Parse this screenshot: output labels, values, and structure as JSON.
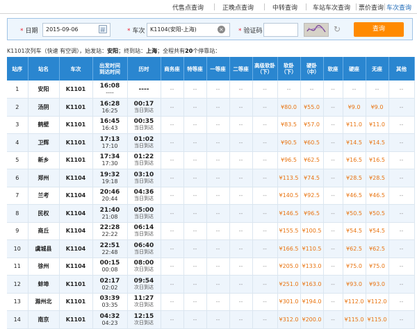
{
  "topnav": {
    "tabs": [
      {
        "label": "代售点查询",
        "active": false
      },
      {
        "label": "正晚点查询",
        "active": false
      },
      {
        "label": "中转查询",
        "active": false
      },
      {
        "label": "车站车次查询",
        "active": false
      },
      {
        "label": "票价查询",
        "active": false
      },
      {
        "label": "车次查询",
        "active": true
      }
    ]
  },
  "query": {
    "date_label": "日期",
    "date_value": "2015-09-06",
    "train_label": "车次",
    "train_value": "K1104(安阳-上海)",
    "captcha_label": "验证码",
    "captcha_value": "",
    "captcha_text": "ઈDR",
    "button_label": "查询",
    "accent_color": "#ff8a00"
  },
  "info": {
    "prefix": "K1101次列车（快速 有空调），始发站：",
    "origin": "安阳",
    "mid": "；终到站：",
    "dest": "上海",
    "suffix_a": "；全程共有",
    "stop_count": "20",
    "suffix_b": "个停靠站："
  },
  "table": {
    "header_color": "#2a86d0",
    "headers": [
      "站序",
      "站名",
      "车次",
      "出发时间\n到达时间",
      "历时",
      "商务座",
      "特等座",
      "一等座",
      "二等座",
      "高级软卧\n（下）",
      "软卧\n（下）",
      "硬卧\n（中）",
      "软座",
      "硬座",
      "无座",
      "其他"
    ],
    "rows": [
      {
        "seq": "1",
        "station": "安阳",
        "train": "K1101",
        "dep": "16:08",
        "arr": "----",
        "dur": "----",
        "day": "",
        "rw": "--",
        "yw": "--",
        "yz": "--",
        "wz": "--"
      },
      {
        "seq": "2",
        "station": "汤阴",
        "train": "K1101",
        "dep": "16:28",
        "arr": "16:25",
        "dur": "00:17",
        "day": "当日到达",
        "rw": "¥80.0",
        "yw": "¥55.0",
        "yz": "¥9.0",
        "wz": "¥9.0"
      },
      {
        "seq": "3",
        "station": "鹤壁",
        "train": "K1101",
        "dep": "16:45",
        "arr": "16:43",
        "dur": "00:35",
        "day": "当日到达",
        "rw": "¥83.5",
        "yw": "¥57.0",
        "yz": "¥11.0",
        "wz": "¥11.0"
      },
      {
        "seq": "4",
        "station": "卫辉",
        "train": "K1101",
        "dep": "17:13",
        "arr": "17:10",
        "dur": "01:02",
        "day": "当日到达",
        "rw": "¥90.5",
        "yw": "¥60.5",
        "yz": "¥14.5",
        "wz": "¥14.5"
      },
      {
        "seq": "5",
        "station": "新乡",
        "train": "K1101",
        "dep": "17:34",
        "arr": "17:30",
        "dur": "01:22",
        "day": "当日到达",
        "rw": "¥96.5",
        "yw": "¥62.5",
        "yz": "¥16.5",
        "wz": "¥16.5"
      },
      {
        "seq": "6",
        "station": "郑州",
        "train": "K1104",
        "dep": "19:32",
        "arr": "19:18",
        "dur": "03:10",
        "day": "当日到达",
        "rw": "¥113.5",
        "yw": "¥74.5",
        "yz": "¥28.5",
        "wz": "¥28.5"
      },
      {
        "seq": "7",
        "station": "兰考",
        "train": "K1104",
        "dep": "20:46",
        "arr": "20:44",
        "dur": "04:36",
        "day": "当日到达",
        "rw": "¥140.5",
        "yw": "¥92.5",
        "yz": "¥46.5",
        "wz": "¥46.5"
      },
      {
        "seq": "8",
        "station": "民权",
        "train": "K1104",
        "dep": "21:40",
        "arr": "21:08",
        "dur": "05:00",
        "day": "当日到达",
        "rw": "¥146.5",
        "yw": "¥96.5",
        "yz": "¥50.5",
        "wz": "¥50.5"
      },
      {
        "seq": "9",
        "station": "商丘",
        "train": "K1104",
        "dep": "22:28",
        "arr": "22:22",
        "dur": "06:14",
        "day": "当日到达",
        "rw": "¥155.5",
        "yw": "¥100.5",
        "yz": "¥54.5",
        "wz": "¥54.5"
      },
      {
        "seq": "10",
        "station": "虞城县",
        "train": "K1104",
        "dep": "22:51",
        "arr": "22:48",
        "dur": "06:40",
        "day": "当日到达",
        "rw": "¥166.5",
        "yw": "¥110.5",
        "yz": "¥62.5",
        "wz": "¥62.5"
      },
      {
        "seq": "11",
        "station": "徐州",
        "train": "K1104",
        "dep": "00:15",
        "arr": "00:08",
        "dur": "08:00",
        "day": "次日到达",
        "rw": "¥205.0",
        "yw": "¥133.0",
        "yz": "¥75.0",
        "wz": "¥75.0"
      },
      {
        "seq": "12",
        "station": "蚌埠",
        "train": "K1101",
        "dep": "02:17",
        "arr": "02:02",
        "dur": "09:54",
        "day": "次日到达",
        "rw": "¥251.0",
        "yw": "¥163.0",
        "yz": "¥93.0",
        "wz": "¥93.0"
      },
      {
        "seq": "13",
        "station": "滁州北",
        "train": "K1101",
        "dep": "03:39",
        "arr": "03:35",
        "dur": "11:27",
        "day": "次日到达",
        "rw": "¥301.0",
        "yw": "¥194.0",
        "yz": "¥112.0",
        "wz": "¥112.0"
      },
      {
        "seq": "14",
        "station": "南京",
        "train": "K1101",
        "dep": "04:32",
        "arr": "04:23",
        "dur": "12:15",
        "day": "次日到达",
        "rw": "¥312.0",
        "yw": "¥200.0",
        "yz": "¥115.0",
        "wz": "¥115.0"
      }
    ],
    "empty_cell": "--"
  }
}
